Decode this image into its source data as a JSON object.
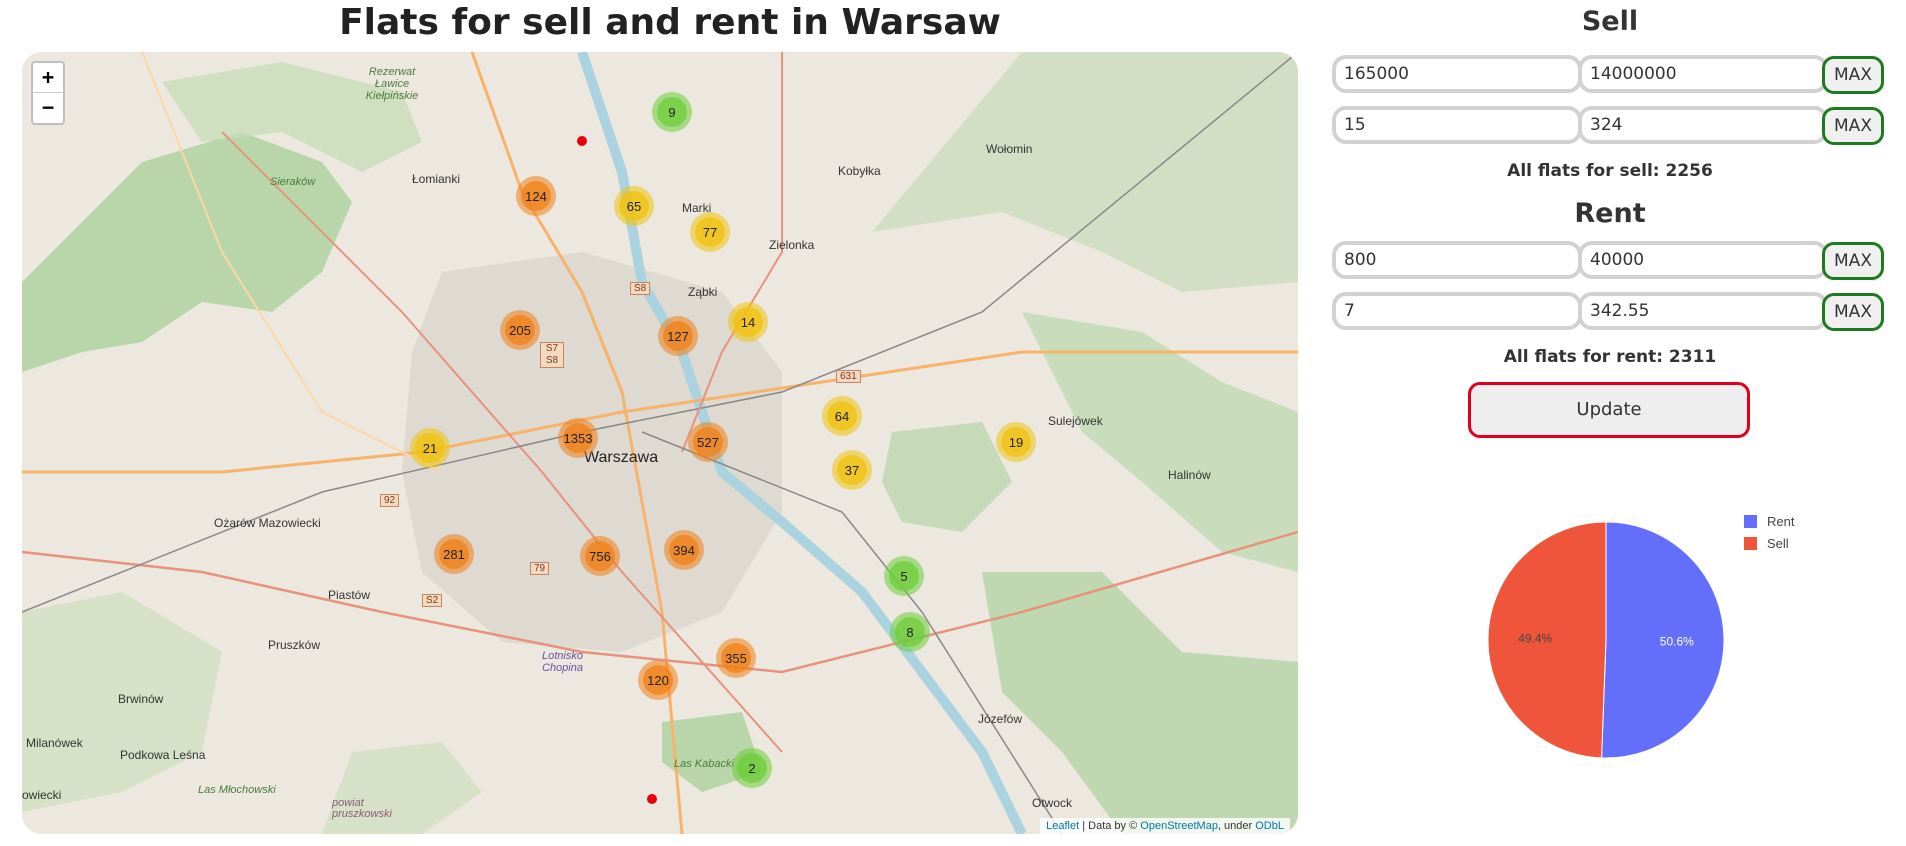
{
  "page_title": "Flats for sell and rent in Warsaw",
  "map": {
    "zoom_in": "+",
    "zoom_out": "−",
    "clusters": [
      {
        "label": "9",
        "color": "green"
      },
      {
        "label": "124",
        "color": "orange"
      },
      {
        "label": "65",
        "color": "yellow"
      },
      {
        "label": "77",
        "color": "yellow"
      },
      {
        "label": "205",
        "color": "orange"
      },
      {
        "label": "127",
        "color": "orange"
      },
      {
        "label": "14",
        "color": "yellow"
      },
      {
        "label": "64",
        "color": "yellow"
      },
      {
        "label": "1353",
        "color": "orange"
      },
      {
        "label": "527",
        "color": "orange"
      },
      {
        "label": "19",
        "color": "yellow"
      },
      {
        "label": "21",
        "color": "yellow"
      },
      {
        "label": "37",
        "color": "yellow"
      },
      {
        "label": "281",
        "color": "orange"
      },
      {
        "label": "756",
        "color": "orange"
      },
      {
        "label": "394",
        "color": "orange"
      },
      {
        "label": "5",
        "color": "green"
      },
      {
        "label": "8",
        "color": "green"
      },
      {
        "label": "355",
        "color": "orange"
      },
      {
        "label": "120",
        "color": "orange"
      },
      {
        "label": "2",
        "color": "green"
      }
    ],
    "places": {
      "lomianki": "Łomianki",
      "warszawa": "Warszawa",
      "marki": "Marki",
      "zielonka": "Zielonka",
      "zabki": "Ząbki",
      "kobylka": "Kobyłka",
      "wolomin": "Wołomin",
      "sulejowek": "Sulejówek",
      "halinow": "Halinów",
      "ozarow": "Ożarów Mazowiecki",
      "piastow": "Piastów",
      "pruszkow": "Pruszków",
      "brwinow": "Brwinów",
      "milanowek": "Milanówek",
      "podkowa": "Podkowa Leśna",
      "jozefow": "Józefów",
      "otwock": "Otwock",
      "owiecki": "owiecki",
      "sierakow": "Sieraków",
      "rezerwat": "Rezerwat Ławice Kiełpińskie",
      "lasy_mlochowskie": "Las Młochowski",
      "lotnisko": "Lotnisko Chopina",
      "las_kabacki": "Las Kabacki",
      "powiat": "powiat pruszkowski"
    },
    "roads": {
      "s8": "S8",
      "s7s8": "S7 S8",
      "r631": "631",
      "r92": "92",
      "r79": "79",
      "s2": "S2"
    },
    "attribution": {
      "leaflet": "Leaflet",
      "text1": " | Data by © ",
      "osm": "OpenStreetMap",
      "text2": ", under ",
      "odbl": "ODbL"
    }
  },
  "sell": {
    "title": "Sell",
    "price_min": "165000",
    "price_max": "14000000",
    "area_min": "15",
    "area_max": "324",
    "max_label": "MAX",
    "count_label": "All flats for sell: 2256"
  },
  "rent": {
    "title": "Rent",
    "price_min": "800",
    "price_max": "40000",
    "area_min": "7",
    "area_max": "342.55",
    "max_label": "MAX",
    "count_label": "All flats for rent: 2311"
  },
  "update_label": "Update",
  "chart_data": {
    "type": "pie",
    "labels": [
      "Rent",
      "Sell"
    ],
    "values": [
      50.6,
      49.4
    ],
    "value_labels": [
      "50.6%",
      "49.4%"
    ],
    "colors": [
      "#636efa",
      "#ef553b"
    ],
    "legend_position": "top-right"
  }
}
